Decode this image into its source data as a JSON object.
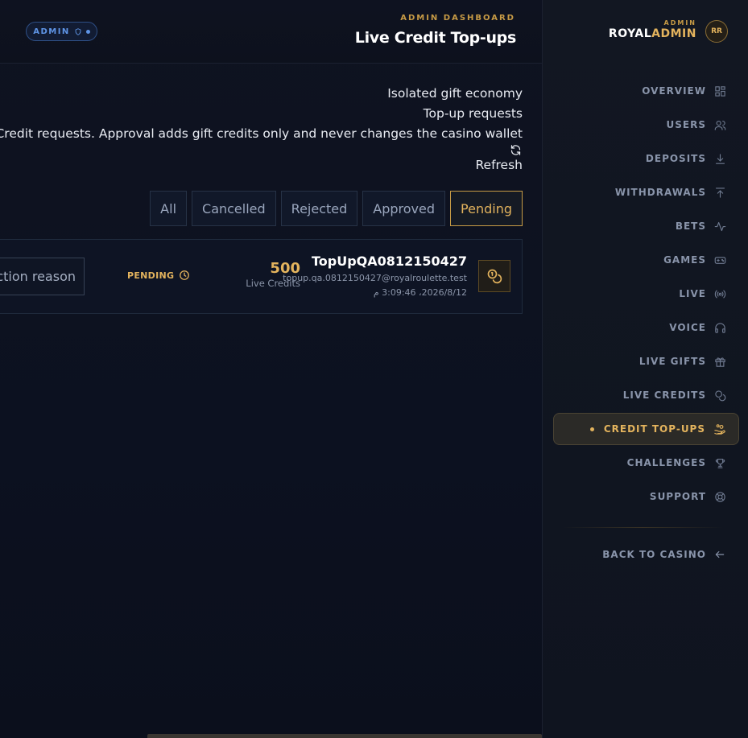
{
  "header": {
    "badge": "ADMIN",
    "kicker": "ADMIN DASHBOARD",
    "title": "Live Credit Top-ups"
  },
  "intro": {
    "eyebrow": "Isolated gift economy",
    "heading": "Top-up requests",
    "description": "e Credit requests. Approval adds gift credits only and never changes the casino wallet",
    "refresh_label": "Refresh"
  },
  "filters": [
    {
      "label": "All"
    },
    {
      "label": "Cancelled"
    },
    {
      "label": "Rejected"
    },
    {
      "label": "Approved"
    },
    {
      "label": "Pending",
      "active": true
    }
  ],
  "request": {
    "reason_placeholder": "ction reason",
    "status": "PENDING",
    "amount": "500",
    "amount_unit": "Live Credits",
    "username": "TopUpQA0812150427",
    "email": "topup.qa.0812150427@royalroulette.test",
    "timestamp": "2026/8/12، 3:09:46 م"
  },
  "sidebar": {
    "brand_kicker": "ADMIN",
    "brand_main": "ROYAL",
    "brand_accent": "ADMIN",
    "avatar_initials": "RR",
    "items": [
      {
        "label": "OVERVIEW",
        "icon": "grid-icon"
      },
      {
        "label": "USERS",
        "icon": "users-icon"
      },
      {
        "label": "DEPOSITS",
        "icon": "download-icon"
      },
      {
        "label": "WITHDRAWALS",
        "icon": "upload-icon"
      },
      {
        "label": "BETS",
        "icon": "activity-icon"
      },
      {
        "label": "GAMES",
        "icon": "gamepad-icon"
      },
      {
        "label": "LIVE",
        "icon": "broadcast-icon"
      },
      {
        "label": "VOICE",
        "icon": "headphones-icon"
      },
      {
        "label": "LIVE GIFTS",
        "icon": "gift-icon"
      },
      {
        "label": "LIVE CREDITS",
        "icon": "coins-icon"
      },
      {
        "label": "CREDIT TOP-UPS",
        "icon": "hand-coins-icon",
        "active": true
      },
      {
        "label": "CHALLENGES",
        "icon": "trophy-icon"
      },
      {
        "label": "SUPPORT",
        "icon": "lifebuoy-icon"
      }
    ],
    "back_label": "BACK TO CASINO"
  },
  "colors": {
    "accent_gold": "#e3b35d",
    "admin_blue": "#5f95e6",
    "background": "#0d1220"
  }
}
